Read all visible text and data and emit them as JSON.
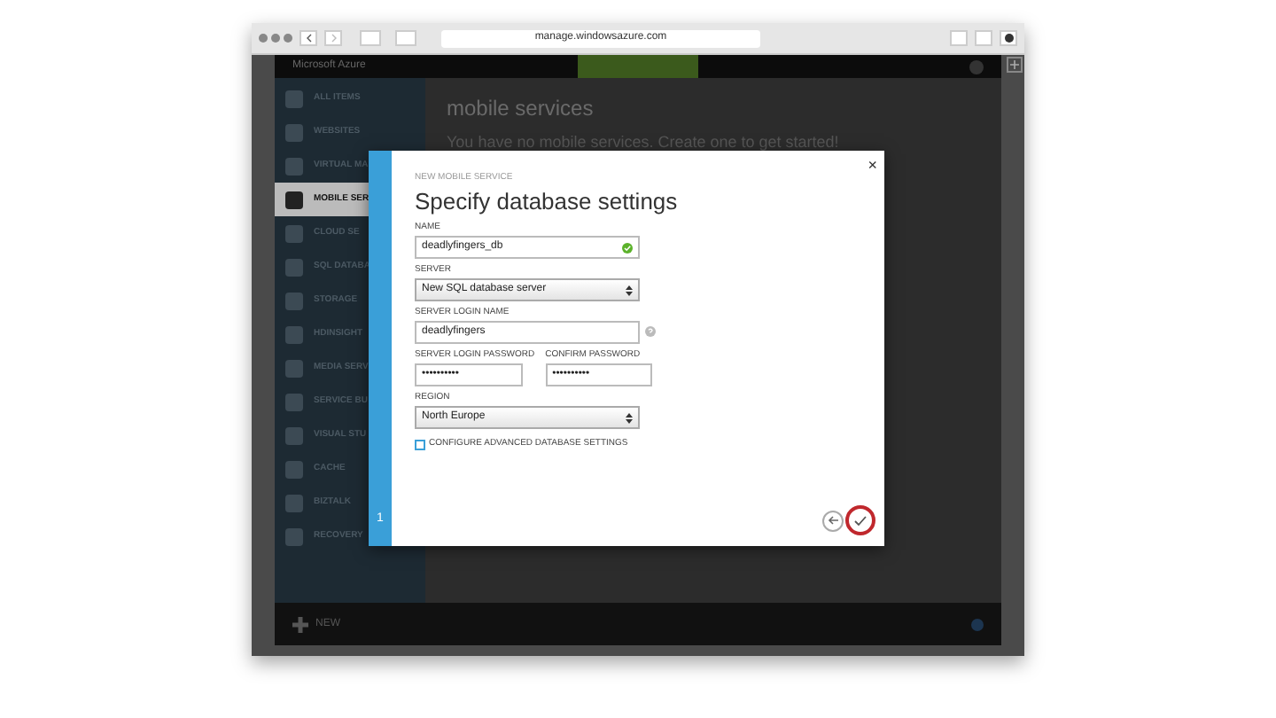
{
  "browser": {
    "url": "manage.windowsazure.com"
  },
  "portal": {
    "brand": "Microsoft Azure",
    "page_title": "mobile services",
    "empty_message": "You have no mobile services. Create one to get started!",
    "new_label": "NEW"
  },
  "sidebar": {
    "items": [
      {
        "label": "ALL ITEMS",
        "selected": false
      },
      {
        "label": "WEBSITES",
        "selected": false
      },
      {
        "label": "VIRTUAL MA",
        "selected": false
      },
      {
        "label": "MOBILE SER",
        "selected": true
      },
      {
        "label": "CLOUD SE",
        "selected": false
      },
      {
        "label": "SQL DATABA",
        "selected": false
      },
      {
        "label": "STORAGE",
        "selected": false
      },
      {
        "label": "HDINSIGHT",
        "selected": false
      },
      {
        "label": "MEDIA SERV",
        "selected": false
      },
      {
        "label": "SERVICE BU",
        "selected": false
      },
      {
        "label": "VISUAL STU",
        "selected": false
      },
      {
        "label": "CACHE",
        "selected": false
      },
      {
        "label": "BIZTALK",
        "selected": false
      },
      {
        "label": "RECOVERY",
        "selected": false
      }
    ]
  },
  "dialog": {
    "overline": "NEW MOBILE SERVICE",
    "title": "Specify database settings",
    "close": "×",
    "step": "1",
    "name": {
      "label": "NAME",
      "value": "deadlyfingers_db",
      "valid": true
    },
    "server": {
      "label": "SERVER",
      "value": "New SQL database server"
    },
    "login_name": {
      "label": "SERVER LOGIN NAME",
      "value": "deadlyfingers"
    },
    "password": {
      "label": "SERVER LOGIN PASSWORD",
      "value": "••••••••••"
    },
    "confirm_password": {
      "label": "CONFIRM PASSWORD",
      "value": "••••••••••"
    },
    "region": {
      "label": "REGION",
      "value": "North Europe"
    },
    "advanced": {
      "label": "CONFIGURE ADVANCED DATABASE SETTINGS",
      "checked": false
    },
    "ok_button": {
      "highlighted": true
    }
  }
}
